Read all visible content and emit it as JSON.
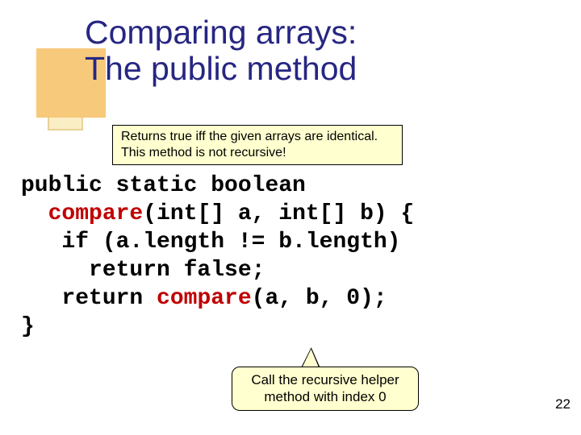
{
  "title": {
    "line1": "Comparing arrays:",
    "line2": "The public method"
  },
  "callout_top": {
    "line1": "Returns true iff the given arrays are identical.",
    "line2": "This method is not recursive!"
  },
  "code": {
    "l1a": "public static boolean",
    "l2a": "  ",
    "l2b": "compare",
    "l2c": "(int[] a, int[] b) {",
    "l3": "   if (a.length != b.length)",
    "l4": "     return false;",
    "l5a": "   return ",
    "l5b": "compare",
    "l5c": "(a, b, 0);",
    "l6": "}"
  },
  "callout_bottom": {
    "line1": "Call the recursive helper",
    "line2": "method with index 0"
  },
  "page_number": "22"
}
